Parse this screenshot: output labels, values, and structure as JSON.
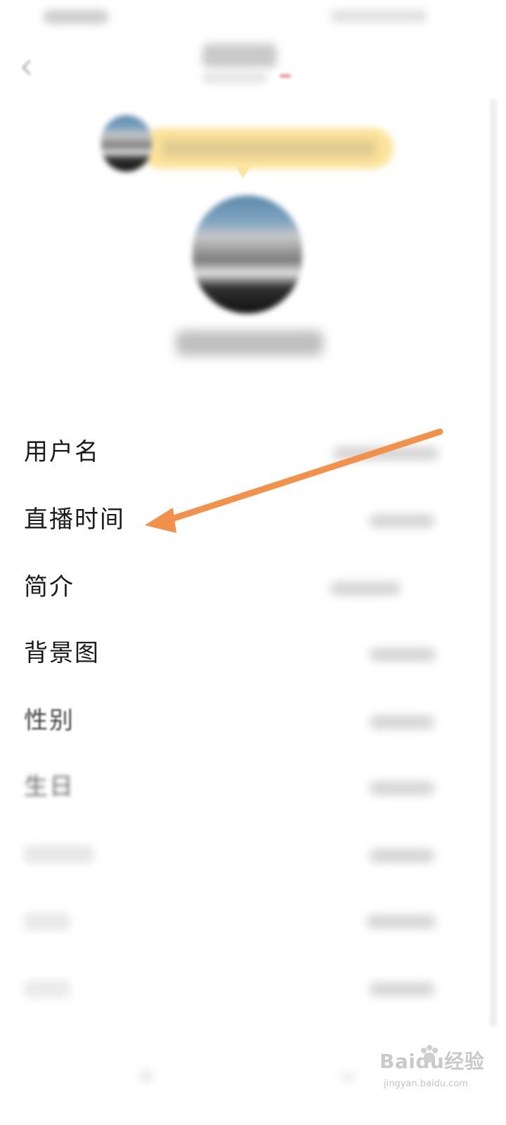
{
  "settings": {
    "rows": [
      {
        "label": "用户名"
      },
      {
        "label": "直播时间"
      },
      {
        "label": "简介"
      },
      {
        "label": "背景图"
      },
      {
        "label": "性别"
      },
      {
        "label": "生日"
      }
    ]
  },
  "annotation": {
    "arrow_color": "#f3914a",
    "points_to": "直播时间"
  },
  "watermark": {
    "logo_text": "Baidu经验",
    "url": "jingyan.baidu.com"
  },
  "colors": {
    "tooltip_bg": "#fde49b",
    "background": "#ffffff"
  },
  "icons": {
    "back": "chevron-left-icon",
    "watermark": "baidu-paw-icon"
  }
}
